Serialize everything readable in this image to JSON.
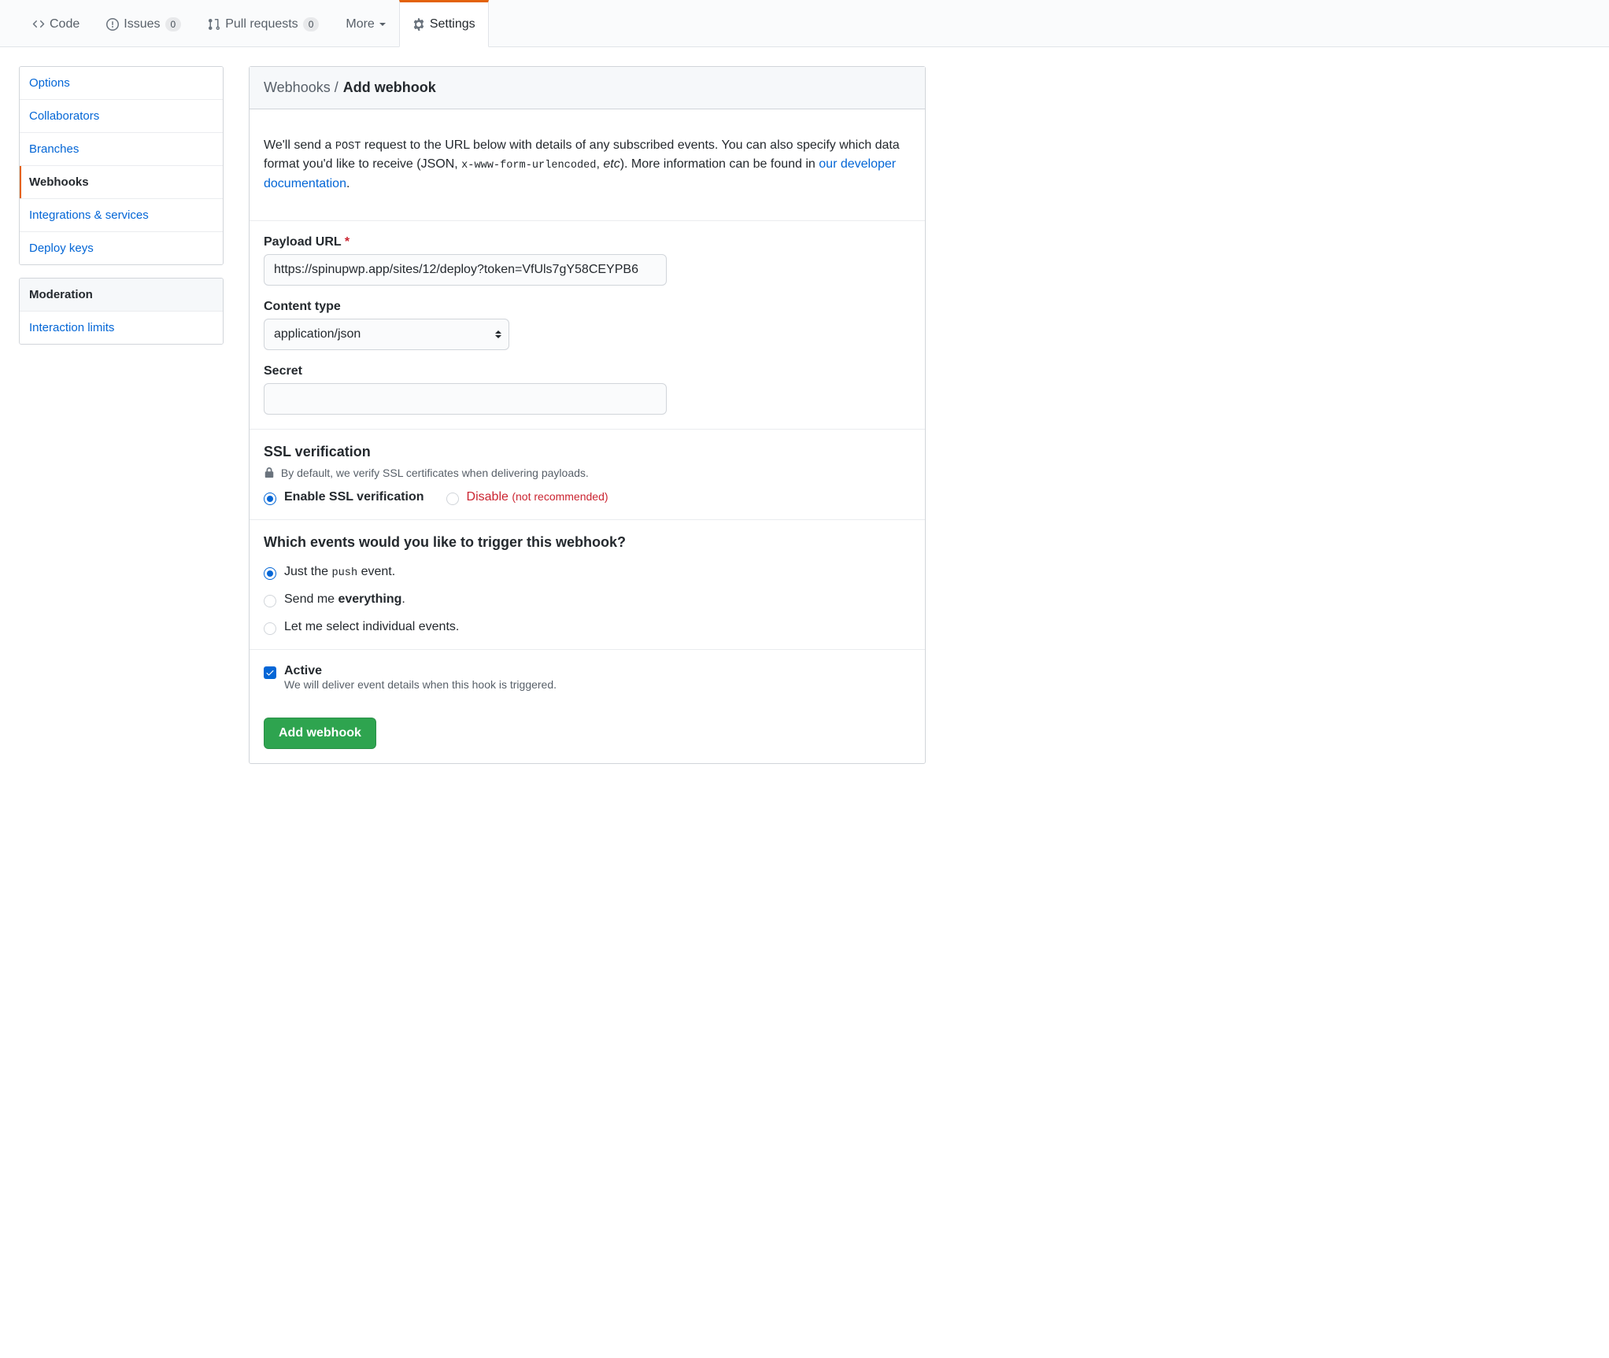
{
  "nav": {
    "code": "Code",
    "issues": "Issues",
    "issues_count": "0",
    "pulls": "Pull requests",
    "pulls_count": "0",
    "more": "More",
    "settings": "Settings"
  },
  "sidebar": {
    "options": "Options",
    "collaborators": "Collaborators",
    "branches": "Branches",
    "webhooks": "Webhooks",
    "integrations": "Integrations & services",
    "deploy_keys": "Deploy keys",
    "moderation_heading": "Moderation",
    "interaction_limits": "Interaction limits"
  },
  "breadcrumb": {
    "parent": "Webhooks",
    "current": "Add webhook"
  },
  "intro": {
    "lead1": "We'll send a ",
    "post_code": "POST",
    "lead2": " request to the URL below with details of any subscribed events. You can also specify which data format you'd like to receive (JSON, ",
    "urlenc_code": "x-www-form-urlencoded",
    "lead3": ", ",
    "etc": "etc",
    "lead4": "). More information can be found in ",
    "link": "our developer documentation",
    "lead5": "."
  },
  "form": {
    "payload_label": "Payload URL",
    "required_mark": "*",
    "payload_value": "https://spinupwp.app/sites/12/deploy?token=VfUls7gY58CEYPB6",
    "content_type_label": "Content type",
    "content_type_value": "application/json",
    "secret_label": "Secret",
    "secret_value": ""
  },
  "ssl": {
    "heading": "SSL verification",
    "note": "By default, we verify SSL certificates when delivering payloads.",
    "enable": "Enable SSL verification",
    "disable": "Disable",
    "disable_note": "(not recommended)"
  },
  "events": {
    "heading": "Which events would you like to trigger this webhook?",
    "just_pre": "Just the ",
    "push_code": "push",
    "just_post": " event.",
    "everything_pre": "Send me ",
    "everything_bold": "everything",
    "everything_post": ".",
    "individual": "Let me select individual events."
  },
  "active": {
    "label": "Active",
    "desc": "We will deliver event details when this hook is triggered."
  },
  "submit": {
    "label": "Add webhook"
  }
}
